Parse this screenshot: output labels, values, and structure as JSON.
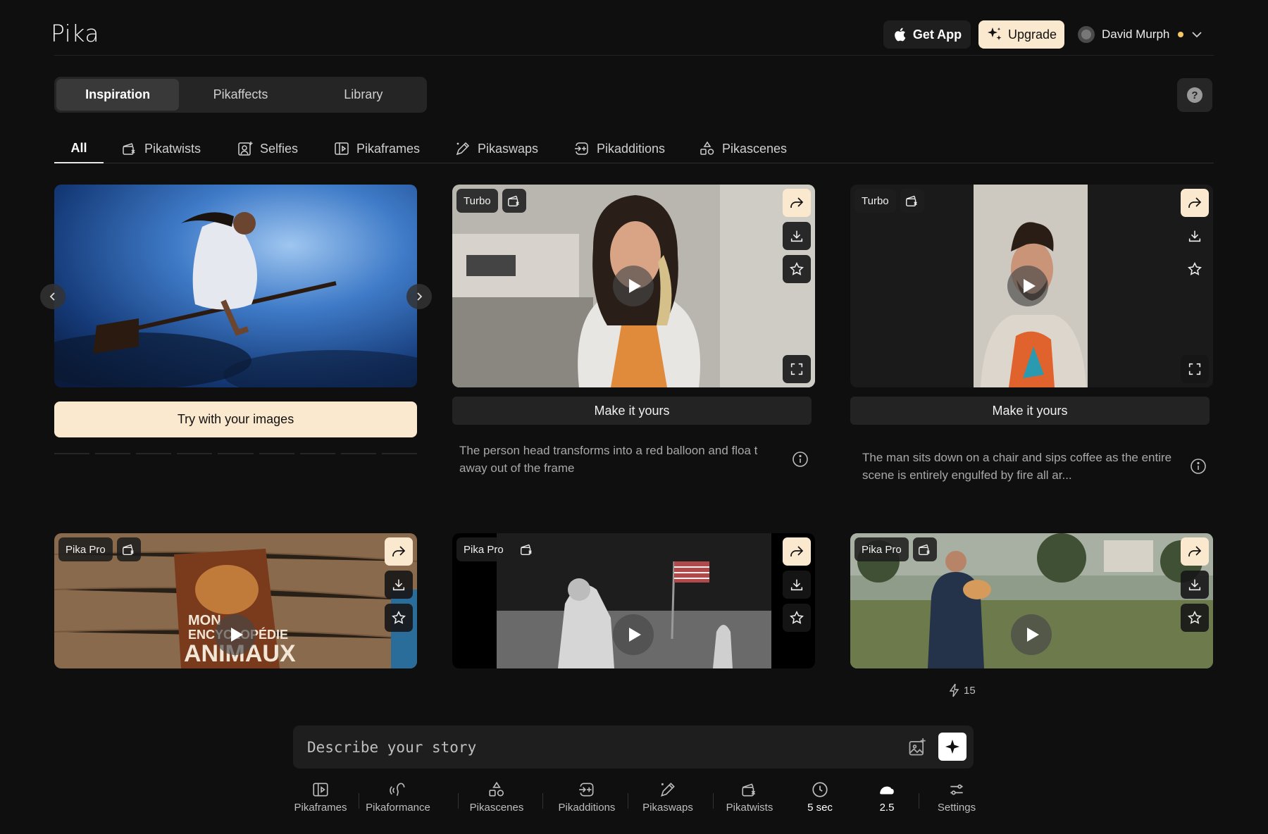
{
  "header": {
    "logo": "Pika",
    "get_app": "Get App",
    "upgrade": "Upgrade",
    "user_name": "David Murph"
  },
  "main_tabs": [
    "Inspiration",
    "Pikaffects",
    "Library"
  ],
  "category_tabs": [
    "All",
    "Pikatwists",
    "Selfies",
    "Pikaframes",
    "Pikaswaps",
    "Pikadditions",
    "Pikascenes"
  ],
  "featured": {
    "try_button": "Try with your images"
  },
  "cards": [
    {
      "badge": "Turbo",
      "make_label": "Make it yours",
      "description": "The person head transforms into a red balloon and floa t away out of the frame"
    },
    {
      "badge": "Turbo",
      "make_label": "Make it yours",
      "description": "The man sits down on a chair and sips coffee as the entire scene is entirely engulfed by fire all ar..."
    },
    {
      "badge": "Pika Pro",
      "book_line1": "MON",
      "book_line2": "ENCYCLOPÉDIE",
      "book_line3": "ANIMAUX"
    },
    {
      "badge": "Pika Pro"
    },
    {
      "badge": "Pika Pro"
    }
  ],
  "credits": "15",
  "prompt": {
    "placeholder": "Describe your story"
  },
  "toolbar": [
    {
      "label": "Pikaframes",
      "icon": "pikaframes-icon"
    },
    {
      "label": "Pikaformance",
      "icon": "pikaformance-icon"
    },
    {
      "label": "Pikascenes",
      "icon": "pikascenes-icon"
    },
    {
      "label": "Pikadditions",
      "icon": "pikadditions-icon"
    },
    {
      "label": "Pikaswaps",
      "icon": "pikaswaps-icon"
    },
    {
      "label": "Pikatwists",
      "icon": "pikatwists-icon"
    },
    {
      "label": "5 sec",
      "icon": "clock-icon"
    },
    {
      "label": "2.5",
      "icon": "model-icon"
    },
    {
      "label": "Settings",
      "icon": "settings-icon"
    }
  ],
  "colors": {
    "background": "#0f0f0f",
    "accent_cream": "#fbe9cf",
    "status_dot": "#f5c866"
  }
}
